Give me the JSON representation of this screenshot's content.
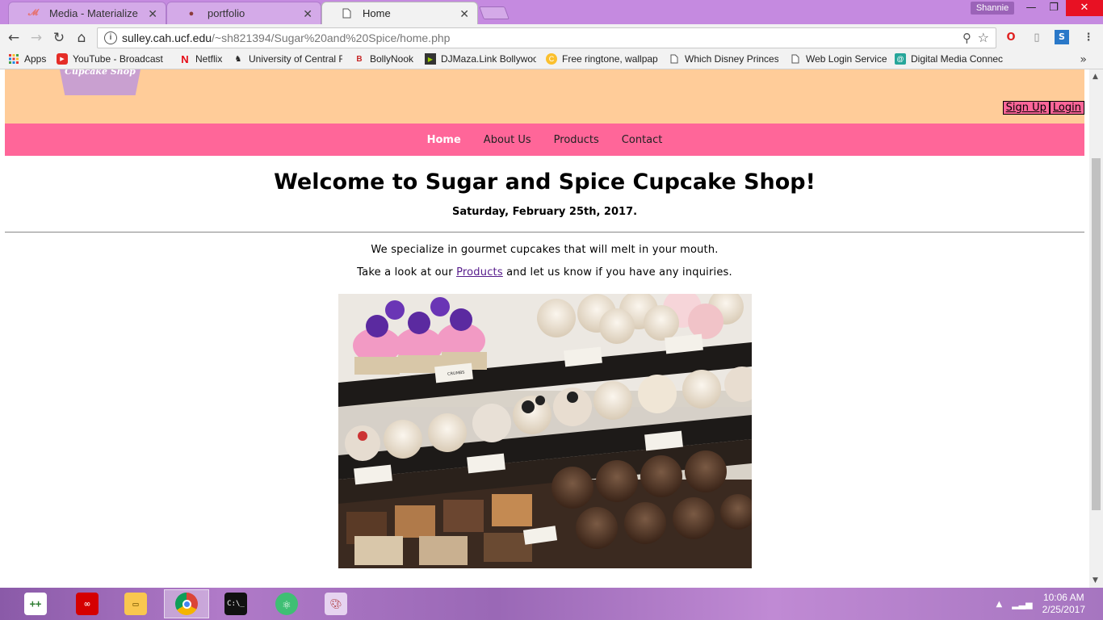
{
  "browser": {
    "tabs": [
      {
        "title": "Media - Materialize",
        "active": false,
        "icon": "materialize-favicon"
      },
      {
        "title": "portfolio",
        "active": false,
        "icon": "portfolio-favicon"
      },
      {
        "title": "Home",
        "active": true,
        "icon": "page-icon"
      }
    ],
    "profile_name": "Shannie",
    "url_host": "sulley.cah.ucf.edu",
    "url_path": "/~sh821394/Sugar%20and%20Spice/home.php"
  },
  "bookmarks": [
    {
      "label": "Apps",
      "icon": "apps-grid-icon"
    },
    {
      "label": "YouTube - Broadcast",
      "icon": "youtube-icon"
    },
    {
      "label": "Netflix",
      "icon": "netflix-icon"
    },
    {
      "label": "University of Central F",
      "icon": "ucf-icon"
    },
    {
      "label": "BollyNook",
      "icon": "bollynook-icon"
    },
    {
      "label": "DJMaza.Link Bollywoo",
      "icon": "djmaza-icon"
    },
    {
      "label": "Free ringtone, wallpap",
      "icon": "ringtone-icon"
    },
    {
      "label": "Which Disney Princes",
      "icon": "page-icon"
    },
    {
      "label": "Web Login Service",
      "icon": "page-icon"
    },
    {
      "label": "Digital Media Connec",
      "icon": "digital-media-icon"
    }
  ],
  "site": {
    "logo_text": "Cupcake Shop",
    "auth": {
      "signup": "Sign Up",
      "login": "Login"
    },
    "nav": [
      {
        "label": "Home",
        "active": true
      },
      {
        "label": "About Us",
        "active": false
      },
      {
        "label": "Products",
        "active": false
      },
      {
        "label": "Contact",
        "active": false
      }
    ],
    "heading": "Welcome to Sugar and Spice Cupcake Shop!",
    "date": "Saturday, February 25th, 2017.",
    "intro": "We specialize in gourmet cupcakes that will melt in your mouth.",
    "cta_before": "Take a look at our ",
    "cta_link": "Products",
    "cta_after": " and let us know if you have any inquiries.",
    "photo_label": "CRUMBS",
    "colors": {
      "header": "#ffcc99",
      "nav": "#ff6699",
      "link": "#551a8b"
    }
  },
  "taskbar": {
    "apps": [
      "notepad-plus-icon",
      "adobe-cc-icon",
      "file-explorer-icon",
      "chrome-icon",
      "terminal-icon",
      "atom-icon",
      "paint-icon"
    ],
    "time": "10:06 AM",
    "date": "2/25/2017"
  }
}
